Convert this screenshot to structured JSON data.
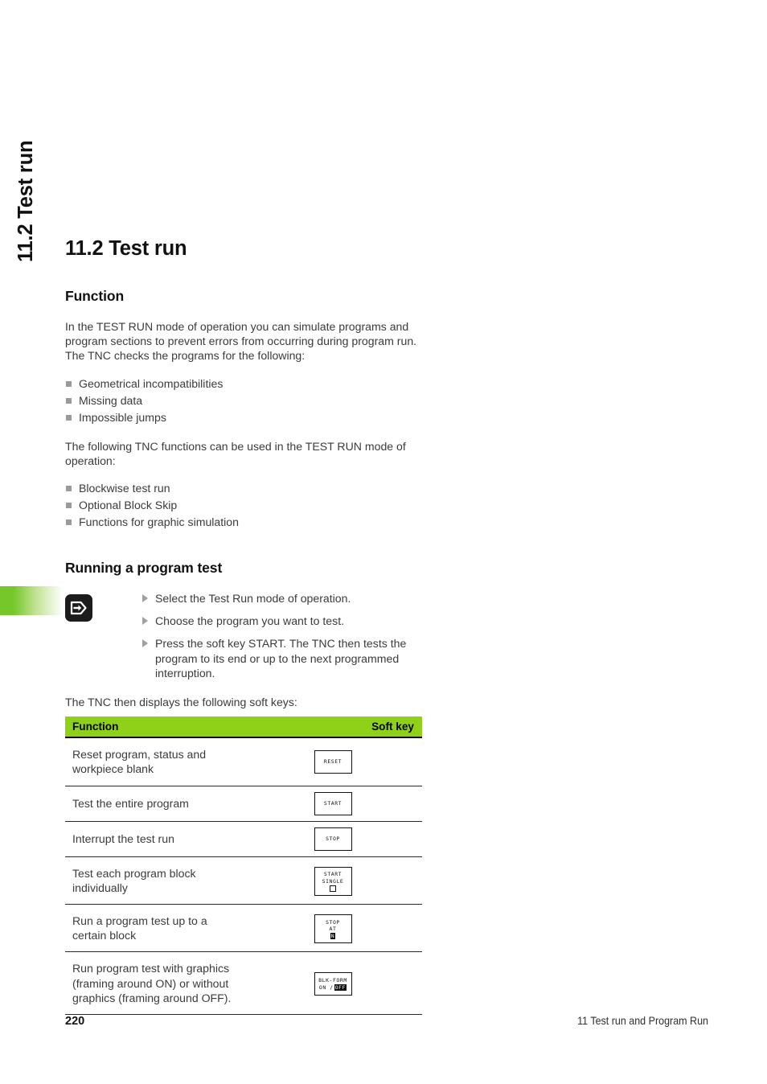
{
  "running_head": "11.2 Test run",
  "chapter": {
    "title": "11.2 Test run"
  },
  "function_section": {
    "heading": "Function",
    "intro": "In the TEST RUN mode of operation you can simulate programs and program sections to prevent errors from occurring during program run. The TNC checks the programs for the following:",
    "checks": [
      "Geometrical incompatibilities",
      "Missing data",
      "Impossible jumps"
    ],
    "functions_intro": "The following TNC functions can be used in the TEST RUN mode of operation:",
    "functions": [
      "Blockwise test run",
      "Optional Block Skip",
      "Functions for graphic simulation"
    ]
  },
  "running_test_section": {
    "heading": "Running a program test",
    "mode_icon": "test-run-mode-icon",
    "steps": [
      "Select the Test Run mode of operation.",
      "Choose the program you want to test.",
      "Press the soft key START. The TNC then tests the program to its end or up to the next programmed interruption."
    ],
    "table_lead_in": "The TNC then displays the following soft keys:"
  },
  "softkey_table": {
    "header_function": "Function",
    "header_softkey": "Soft key",
    "header_bg": "#8fd119",
    "rows": [
      {
        "function": "Reset program, status and workpiece blank",
        "key_lines": [
          "RESET"
        ]
      },
      {
        "function": "Test the entire program",
        "key_lines": [
          "START"
        ]
      },
      {
        "function": "Interrupt the test run",
        "key_lines": [
          "STOP"
        ]
      },
      {
        "function": "Test each program block individually",
        "key_lines": [
          "START",
          "SINGLE",
          "□"
        ]
      },
      {
        "function": "Run a program test up to a certain block",
        "key_lines": [
          "STOP",
          "AT",
          "N"
        ]
      },
      {
        "function": "Run program test with graphics (framing around ON) or without graphics (framing around OFF).",
        "key_lines": [
          "BLK-FORM",
          "ON / OFF"
        ]
      }
    ]
  },
  "footer": {
    "page_number": "220",
    "title": "11 Test run and Program Run"
  }
}
